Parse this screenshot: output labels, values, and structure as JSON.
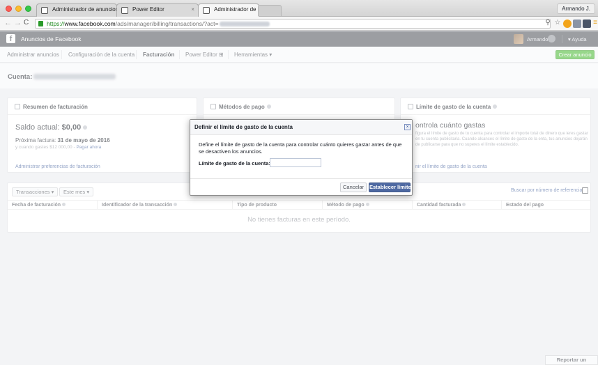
{
  "browser": {
    "tabs": [
      {
        "label": "Administrador de anuncios",
        "close": "×"
      },
      {
        "label": "Power Editor",
        "close": "×"
      },
      {
        "label": "Administrador de anuncios",
        "close": "×"
      }
    ],
    "profile_name": "Armando J.",
    "url_scheme": "https://",
    "url_host": "www.facebook.com",
    "url_path": "/ads/manager/billing/transactions/?act=",
    "colors": {
      "secure": "#1e8a1e"
    }
  },
  "fb_header": {
    "logo": "f",
    "title": "Anuncios de Facebook",
    "user_name": "Armando",
    "help": "▾ Ayuda"
  },
  "nav": {
    "items": [
      "Administrar anuncios",
      "Configuración de la cuenta",
      "Facturación",
      "Power Editor ⊞",
      "Herramientas ▾"
    ],
    "active": "Facturación",
    "create_button": "Crear anuncio",
    "create_color": "#42b72a"
  },
  "account": {
    "label": "Cuenta:"
  },
  "cards": {
    "billing_summary": {
      "title": "Resumen de facturación",
      "balance_label": "Saldo actual:",
      "balance_value": "$0,00",
      "next_invoice_label": "Próxima factura:",
      "next_invoice_value": "31 de mayo de 2016",
      "threshold_text": "y cuando gastes $12 000,00 - ",
      "threshold_link": "Pagar ahora",
      "manage_link": "Administrar preferencias de facturación"
    },
    "payment_methods": {
      "title": "Métodos de pago"
    },
    "spend_limit": {
      "title": "Límite de gasto de la cuenta",
      "heading": "ontrola cuánto gastas",
      "text": "figura el límite de gasto de tu cuenta para controlar el importe total de dinero que ieres gastar en tu cuenta publicitaria. Cuando alcances el límite de gasto de la enta, tus anuncios dejarán de publicarse para que no superes el límite establecido.",
      "link": "nir el límite de gasto de la cuenta"
    }
  },
  "transactions": {
    "filters": [
      "Transacciones ▾",
      "Este mes ▾"
    ],
    "search_link": "Buscar por número de referencia",
    "columns": [
      "Fecha de facturación",
      "Identificador de la transacción",
      "Tipo de producto",
      "Método de pago",
      "Cantidad facturada",
      "Estado del pago"
    ],
    "empty_message": "No tienes facturas en este período."
  },
  "report_button": "Reportar un problema",
  "modal": {
    "title": "Definir el límite de gasto de la cuenta",
    "close": "×",
    "description": "Define el límite de gasto de la cuenta para controlar cuánto quieres gastar antes de que se desactiven los anuncios.",
    "limit_label": "Límite de gasto de la cuenta:",
    "limit_value": "",
    "cancel": "Cancelar",
    "submit": "Establecer límite",
    "submit_color": "#4e69a2"
  }
}
